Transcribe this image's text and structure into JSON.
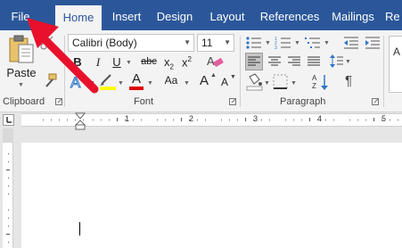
{
  "tabs": [
    {
      "label": "File"
    },
    {
      "label": "Home"
    },
    {
      "label": "Insert"
    },
    {
      "label": "Design"
    },
    {
      "label": "Layout"
    },
    {
      "label": "References"
    },
    {
      "label": "Mailings"
    },
    {
      "label": "Re"
    }
  ],
  "clipboard": {
    "paste_label": "Paste",
    "group_label": "Clipboard"
  },
  "font": {
    "font_name": "Calibri (Body)",
    "font_size": "11",
    "bold": "B",
    "italic": "I",
    "underline": "U",
    "strikethrough": "abc",
    "subscript": "x",
    "superscript": "x",
    "subscript_mark": "2",
    "superscript_mark": "2",
    "grow_font": "A",
    "shrink_font": "A",
    "change_case": "Aa",
    "text_effects": "A",
    "font_color": "A",
    "grow_size": "A",
    "shrink_size": "A",
    "group_label": "Font"
  },
  "paragraph": {
    "group_label": "Paragraph",
    "pilcrow": "¶"
  },
  "ruler": {
    "numbers": [
      "1",
      "2",
      "3",
      "4",
      "5"
    ]
  },
  "colors": {
    "accent": "#2b579a",
    "arrow": "#e8102b",
    "highlight": "#ffff00",
    "font_color": "#e00000"
  },
  "icons": {
    "paste": "clipboard-icon",
    "format_painter": "paintbrush-icon",
    "cut": "scissors-icon"
  }
}
